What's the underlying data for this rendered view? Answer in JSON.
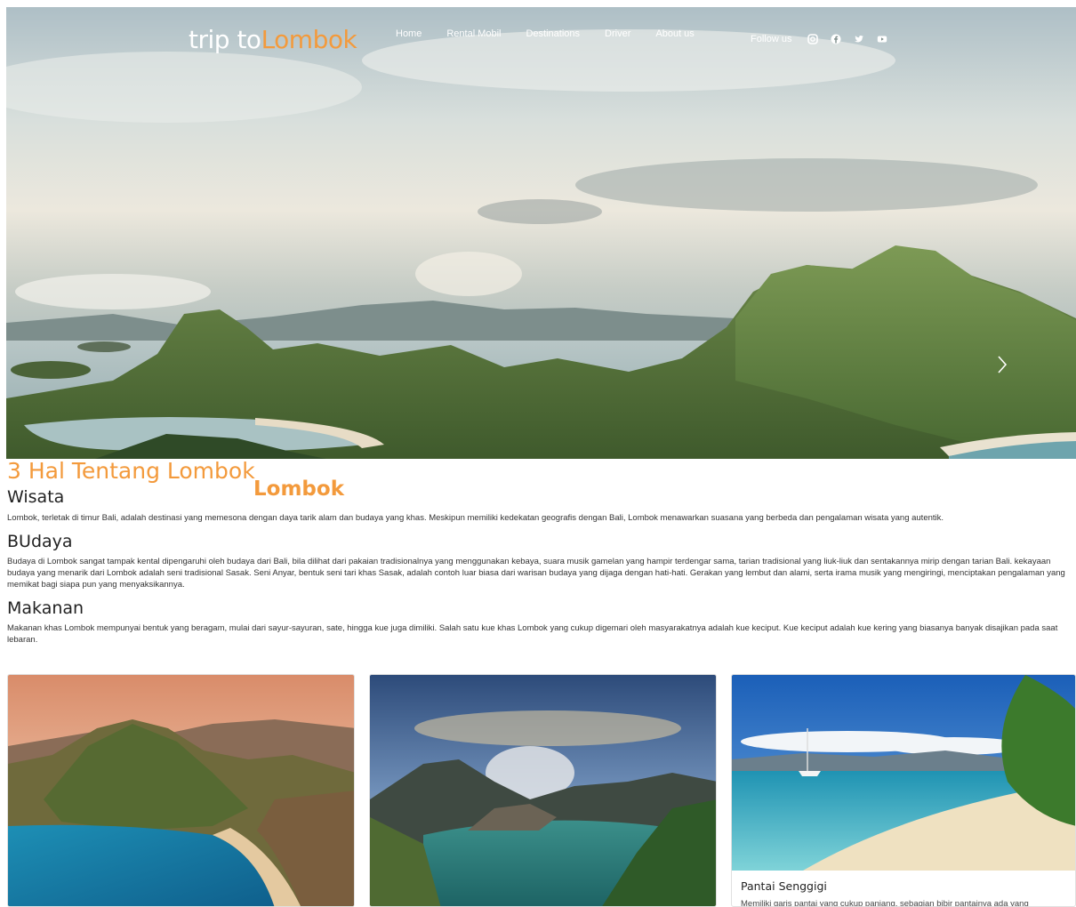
{
  "nav": {
    "brand_prefix": "trip to",
    "brand_highlight": "Lombok",
    "links": [
      "Home",
      "Rental Mobil",
      "Destinations",
      "Driver",
      "About us"
    ],
    "follow_label": "Follow us",
    "social_icons": [
      "instagram-icon",
      "facebook-icon",
      "twitter-icon",
      "youtube-icon"
    ]
  },
  "hero": {
    "next_icon": "chevron-right-icon"
  },
  "content": {
    "title": "3 Hal Tentang Lombok",
    "brand_word": "Lombok",
    "sections": [
      {
        "heading": "Wisata",
        "text": "Lombok, terletak di timur Bali, adalah destinasi yang memesona dengan daya tarik alam dan budaya yang khas. Meskipun memiliki kedekatan geografis dengan Bali, Lombok menawarkan suasana yang berbeda dan pengalaman wisata yang autentik."
      },
      {
        "heading": "BUdaya",
        "text": "Budaya di Lombok sangat tampak kental dipengaruhi oleh budaya dari Bali, bila dilihat dari pakaian tradisionalnya yang menggunakan kebaya, suara musik gamelan yang hampir terdengar sama, tarian tradisional yang liuk-liuk dan sentakannya mirip dengan tarian Bali. kekayaan budaya yang menarik dari Lombok adalah seni tradisional Sasak. Seni Anyar, bentuk seni tari khas Sasak, adalah contoh luar biasa dari warisan budaya yang dijaga dengan hati-hati. Gerakan yang lembut dan alami, serta irama musik yang mengiringi, menciptakan pengalaman yang memikat bagi siapa pun yang menyaksikannya."
      },
      {
        "heading": "Makanan",
        "text": "Makanan khas Lombok mempunyai bentuk yang beragam, mulai dari sayur-sayuran, sate, hingga kue juga dimiliki. Salah satu kue khas Lombok yang cukup digemari oleh masyarakatnya adalah kue keciput. Kue keciput adalah kue kering yang biasanya banyak disajikan pada saat lebaran."
      }
    ]
  },
  "cards": [
    {
      "title": "",
      "text": ""
    },
    {
      "title": "",
      "text": ""
    },
    {
      "title": "Pantai Senggigi",
      "text": "Memiliki garis pantai yang cukup panjang, sebagian bibir pantainya ada yang"
    }
  ],
  "colors": {
    "accent": "#f39a3c",
    "nav_text": "#ffffff"
  }
}
